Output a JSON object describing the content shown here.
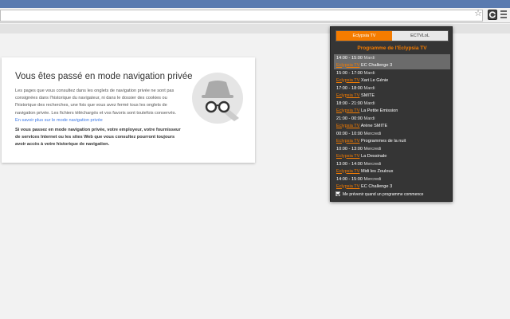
{
  "browser": {
    "star_icon": "star-icon",
    "menu_icon": "hamburger-menu-icon",
    "extension_icon": "eclypsia-extension-icon"
  },
  "incognito": {
    "title": "Vous êtes passé en mode navigation privée",
    "para1": "Les pages que vous consultez dans les onglets de navigation privée ne sont pas consignées dans l'historique du navigateur, ni dans le dossier des cookies ou l'historique des recherches, une fois que vous avez fermé tous les onglets de navigation privée. Les fichiers téléchargés et vos favoris sont toutefois conservés.",
    "link": "En savoir plus sur le mode navigation privée",
    "para2": "Si vous passez en mode navigation privée, votre employeur, votre fournisseur de services Internet ou les sites Web que vous consultez pourront toujours avoir accès à votre historique de navigation."
  },
  "popup": {
    "tabs": [
      "Eclypsia TV",
      "ECTVLoL"
    ],
    "title": "Programme de l'Eclypsia TV",
    "programs": [
      {
        "time": "14:00 - 15:00",
        "day": "Mardi",
        "channel": "Eclypsia TV",
        "show": "EC Challenge 3",
        "current": true
      },
      {
        "time": "15:00 - 17:00",
        "day": "Mardi",
        "channel": "Eclypsia TV",
        "show": "Xari Le Génie",
        "current": false
      },
      {
        "time": "17:00 - 18:00",
        "day": "Mardi",
        "channel": "Eclypsia TV",
        "show": "SMITE",
        "current": false
      },
      {
        "time": "18:00 - 21:00",
        "day": "Mardi",
        "channel": "Eclypsia TV",
        "show": "La Petite Emission",
        "current": false
      },
      {
        "time": "21:00 - 00:00",
        "day": "Mardi",
        "channel": "Eclypsia TV",
        "show": "Arène SMITE",
        "current": false
      },
      {
        "time": "00:00 - 10:00",
        "day": "Mercredi",
        "channel": "Eclypsia TV",
        "show": "Programmes de la nuit",
        "current": false
      },
      {
        "time": "10:00 - 13:00",
        "day": "Mercredi",
        "channel": "Eclypsia TV",
        "show": "La Dessinale",
        "current": false
      },
      {
        "time": "13:00 - 14:00",
        "day": "Mercredi",
        "channel": "Eclypsia TV",
        "show": "Midi les Zouloux",
        "current": false
      },
      {
        "time": "14:00 - 15:00",
        "day": "Mercredi",
        "channel": "Eclypsia TV",
        "show": "EC Challenge 3",
        "current": false
      }
    ],
    "notify_label": "Me prévenir quand un programme commence",
    "notify_checked": true
  },
  "colors": {
    "accent": "#f57c00",
    "popup_bg": "#353535",
    "link": "#3b78e7"
  }
}
